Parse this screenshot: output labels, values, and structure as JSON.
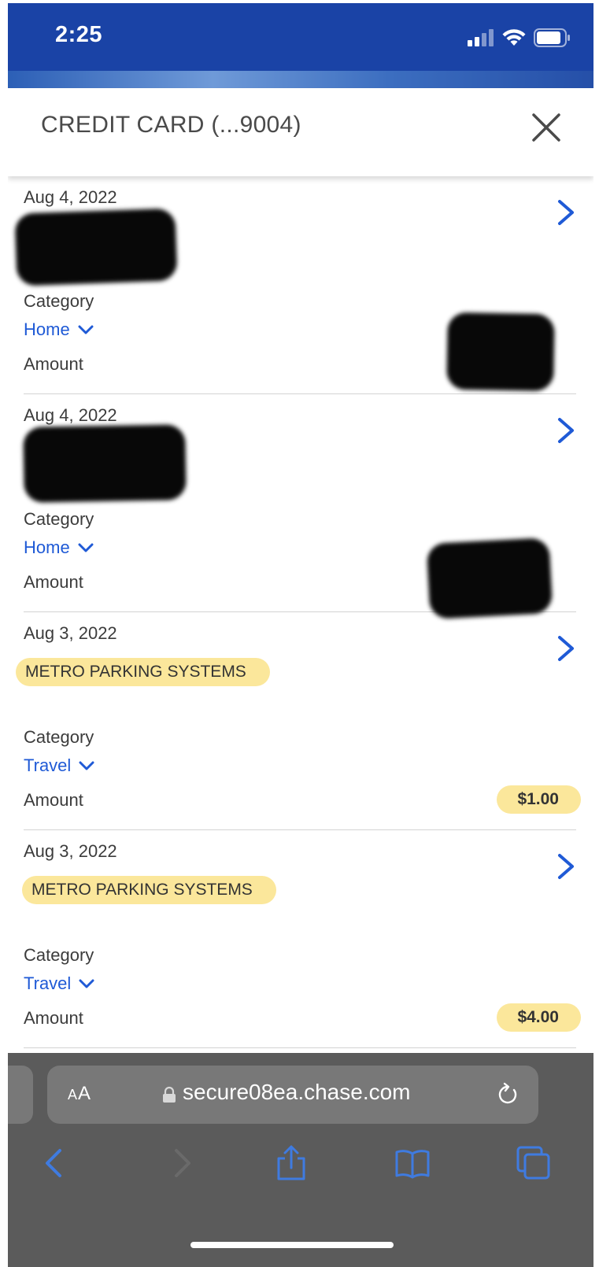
{
  "status_bar": {
    "time": "2:25",
    "icons": [
      "cellular-signal-icon",
      "wifi-icon",
      "battery-icon"
    ]
  },
  "header": {
    "title": "CREDIT CARD (...9004)",
    "close_icon": "close-icon"
  },
  "transactions": [
    {
      "date": "Aug 4, 2022",
      "merchant": "",
      "category_label": "Category",
      "category": "Home",
      "amount_label": "Amount",
      "amount": "",
      "redacted": true
    },
    {
      "date": "Aug 4, 2022",
      "merchant": "",
      "category_label": "Category",
      "category": "Home",
      "amount_label": "Amount",
      "amount": "",
      "redacted": true
    },
    {
      "date": "Aug 3, 2022",
      "merchant": "METRO PARKING SYSTEMS",
      "category_label": "Category",
      "category": "Travel",
      "amount_label": "Amount",
      "amount": "$1.00",
      "redacted": false
    },
    {
      "date": "Aug 3, 2022",
      "merchant": "METRO PARKING SYSTEMS",
      "category_label": "Category",
      "category": "Travel",
      "amount_label": "Amount",
      "amount": "$4.00",
      "redacted": false
    }
  ],
  "browser": {
    "text_size_label_small": "A",
    "text_size_label_large": "A",
    "url": "secure08ea.chase.com",
    "nav_icons": [
      "back-icon",
      "forward-icon",
      "share-icon",
      "bookmarks-icon",
      "tabs-icon"
    ]
  },
  "colors": {
    "status_bar": "#1a43a6",
    "link_blue": "#1f5ad6",
    "highlight": "#fbe79b",
    "browser_bg": "#5b5b5b"
  }
}
